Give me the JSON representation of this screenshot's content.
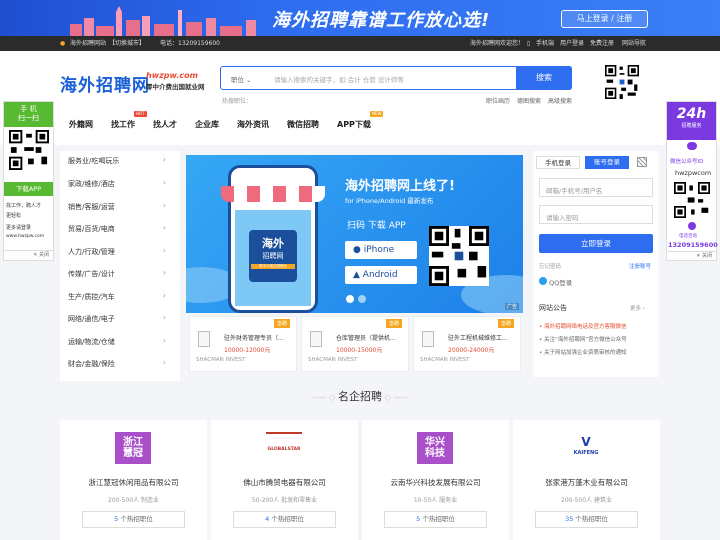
{
  "banner": {
    "slogan": "海外招聘靠谱工作放心选!",
    "login_label": "马上登录 / 注册"
  },
  "topbar": {
    "site": "海外招聘网站",
    "switch_city": "【切换城市】",
    "phone": "电话：13209159600",
    "welcome": "海外招聘网欢迎您！",
    "mobile": "手机端",
    "user_login": "用户登录",
    "register": "免费注册",
    "site_nav": "网站导航"
  },
  "header": {
    "logo": "海外招聘网",
    "domain": "hwzpw.com",
    "tagline": "零中介费出国就业网",
    "search": {
      "select": "职位",
      "placeholder": "请输入搜索的关键字，如:会计 仓管 设计师等",
      "button": "搜索"
    },
    "hot_label": "热搜职位：",
    "adv_links": [
      "职位画历",
      "德图搜索",
      "高级搜索"
    ]
  },
  "nav": [
    {
      "label": "外籍网",
      "badge": ""
    },
    {
      "label": "找工作",
      "badge": "HOT"
    },
    {
      "label": "找人才",
      "badge": ""
    },
    {
      "label": "企业库",
      "badge": ""
    },
    {
      "label": "海外资讯",
      "badge": ""
    },
    {
      "label": "微信招聘",
      "badge": ""
    },
    {
      "label": "APP下载",
      "badge": "NEW"
    }
  ],
  "left_float": {
    "head1": "手 机",
    "head2": "扫一扫",
    "download": "下载APP",
    "line1": "找工作，聘人才",
    "line2": "更轻松",
    "line3": "更多请登录",
    "url": "www.hwzpw.com",
    "close": "关闭"
  },
  "right_float": {
    "big": "24h",
    "small": "招聘服务",
    "wechat_label": "微信公众号ID",
    "wechat_id": "hwzpwcom",
    "phone_label": "电话咨询",
    "phone": "13209159600",
    "close": "关闭"
  },
  "categories": [
    "服务业/吃喝玩乐",
    "家政/维修/酒店",
    "销售/客服/运营",
    "贸易/百货/电商",
    "人力/行政/管理",
    "传媒/广告/设计",
    "生产/质控/汽车",
    "网络/通信/电子",
    "运输/物流/仓储",
    "财会/金融/保险"
  ],
  "hero": {
    "title": "海外招聘网上线了!",
    "subtitle": "for iPhone/Android 最新发布",
    "scan": "扫码 下载 APP",
    "iphone": "iPhone",
    "android": "Android",
    "phone_text1": "海外",
    "phone_text2": "招聘网",
    "phone_text3": "零中介费出国就业",
    "ad": "广告"
  },
  "jobs": [
    {
      "title": "驻外财务管理专员（...",
      "salary": "10000-12000元",
      "company": "SHACMAN INVEST",
      "tag": "急聘"
    },
    {
      "title": "仓库管理员（提供机...",
      "salary": "10000-15000元",
      "company": "SHACMAN INVEST",
      "tag": "急聘"
    },
    {
      "title": "驻外工程机械维修工...",
      "salary": "20000-24000元",
      "company": "SHACMAN INVEST",
      "tag": "急聘"
    }
  ],
  "login": {
    "tab_mobile": "手机登录",
    "tab_account": "账号登录",
    "email_placeholder": "邮箱/手机号/用户名",
    "password_placeholder": "请输入密码",
    "button": "立即登录",
    "forgot": "忘记密码",
    "register": "注册账号",
    "qq": "QQ登录"
  },
  "notice": {
    "title": "网站公告",
    "more": "更多",
    "items": [
      "海外招聘网络电话及官方客服微信",
      "关注“海外招聘网”官方微信公众号",
      "关于网站加强企业资质审核的通知"
    ]
  },
  "section_title": "名企招聘",
  "companies": [
    {
      "logo": "浙江\n慧冠",
      "name": "浙江慧冠休闲用品有限公司",
      "meta": "200-500人    制造业",
      "count": "5",
      "count_suffix": " 个热招职位",
      "color": "#a84fc9"
    },
    {
      "logo": "GLOBALSTAR",
      "name": "佛山市腾贸电器有限公司",
      "meta": "50-200人    批发和零售业",
      "count": "4",
      "count_suffix": " 个热招职位",
      "color": "#c0392b"
    },
    {
      "logo": "华兴\n科技",
      "name": "云南华兴科技发展有限公司",
      "meta": "10-50人    服务业",
      "count": "5",
      "count_suffix": " 个热招职位",
      "color": "#a84fc9"
    },
    {
      "logo": "KAIFENG",
      "name": "张家港万蓬木业有限公司",
      "meta": "200-500人    建筑业",
      "count": "35",
      "count_suffix": " 个热招职位",
      "color": "#1a3fa8"
    }
  ]
}
